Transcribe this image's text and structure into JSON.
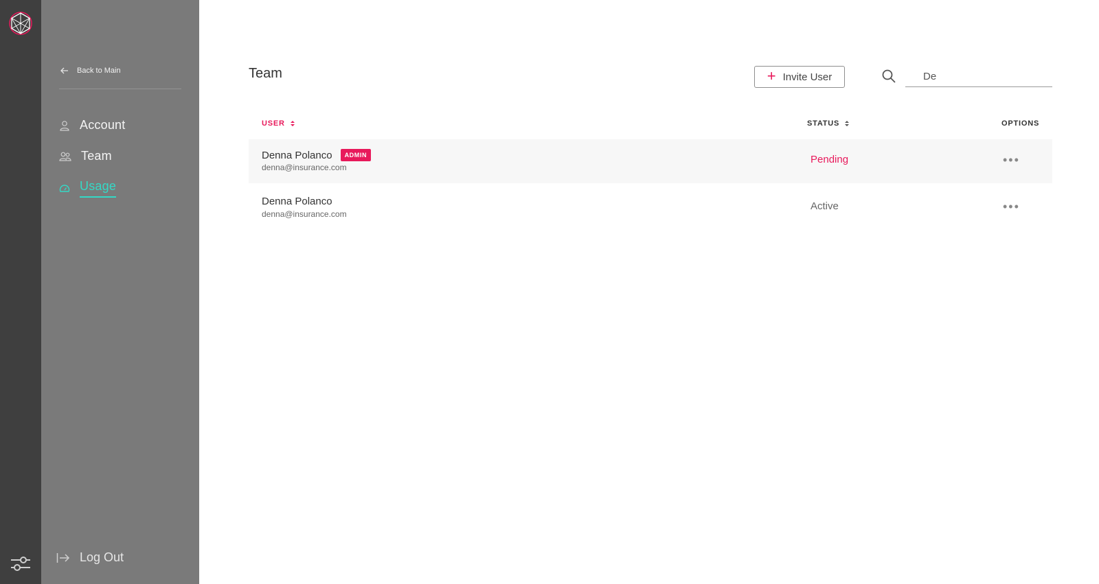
{
  "sidebar": {
    "back_label": "Back to Main",
    "items": [
      {
        "label": "Account",
        "icon": "user-icon"
      },
      {
        "label": "Team",
        "icon": "team-icon"
      },
      {
        "label": "Usage",
        "icon": "gauge-icon",
        "active": true
      }
    ],
    "logout_label": "Log Out"
  },
  "main": {
    "title": "Team",
    "invite_label": "Invite User",
    "search_value": "De",
    "columns": {
      "user": "USER",
      "status": "STATUS",
      "options": "OPTIONS"
    },
    "rows": [
      {
        "name": "Denna Polanco",
        "badge": "ADMIN",
        "email": "denna@insurance.com",
        "status": "Pending"
      },
      {
        "name": "Denna Polanco",
        "email": "denna@insurance.com",
        "status": "Active"
      }
    ],
    "options_glyph": "•••"
  },
  "colors": {
    "accent": "#e8195b",
    "active_nav": "#34d9c6",
    "rail": "#3f3f3f",
    "sidebar": "#7a7a7a"
  }
}
